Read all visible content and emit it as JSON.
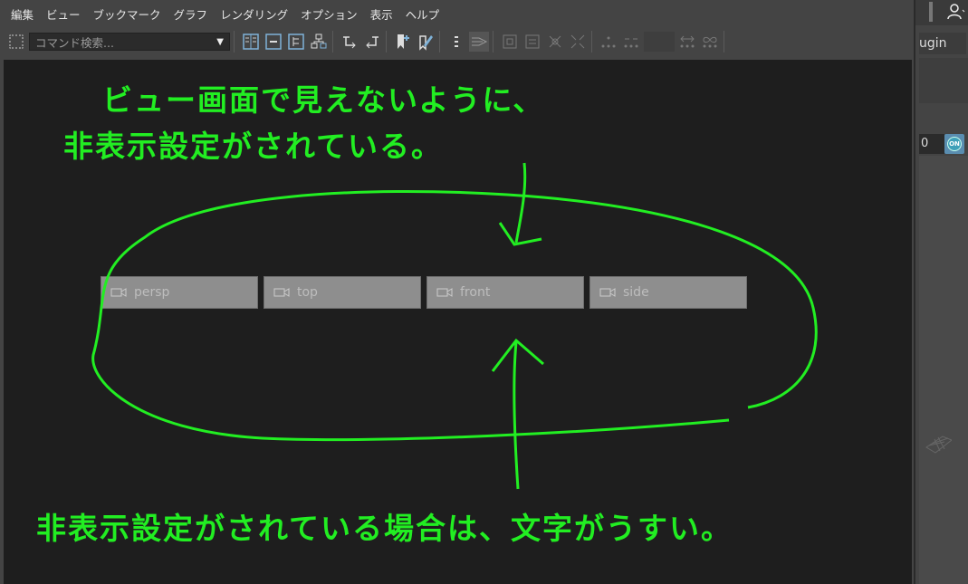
{
  "menu": [
    "編集",
    "ビュー",
    "ブックマーク",
    "グラフ",
    "レンダリング",
    "オプション",
    "表示",
    "ヘルプ"
  ],
  "toolbar": {
    "command_search_placeholder": "コマンド検索...",
    "icons": [
      "outliner-layout-icon",
      "collapse-icon",
      "expand-icon",
      "hierarchy-icon",
      "input-connections-icon",
      "output-connections-icon",
      "add-bookmark-icon",
      "edit-bookmark-icon",
      "list-icon",
      "stack-icon",
      "frame-selection-icon",
      "frame-all-icon",
      "isolate-icon",
      "isolate-clear-icon",
      "graph-options-icon",
      "connect-icon",
      "spacer",
      "swap-icon",
      "infinity-icon"
    ]
  },
  "cameras": [
    {
      "name": "persp"
    },
    {
      "name": "top"
    },
    {
      "name": "front"
    },
    {
      "name": "side"
    }
  ],
  "annotations": {
    "line1": "ビュー画面で見えないように、",
    "line2": "非表示設定がされている。",
    "line3": "非表示設定がされている場合は、文字がうすい。",
    "color": "#22ee22"
  },
  "side_panel": {
    "plugin_text": "ugin",
    "number_value": "0",
    "on_label": "ON"
  },
  "colors": {
    "viewport_bg": "#1e1e1e",
    "camera_bg": "#8e8e8e",
    "camera_text": "#bdbdbd",
    "annotation": "#22ee22"
  }
}
